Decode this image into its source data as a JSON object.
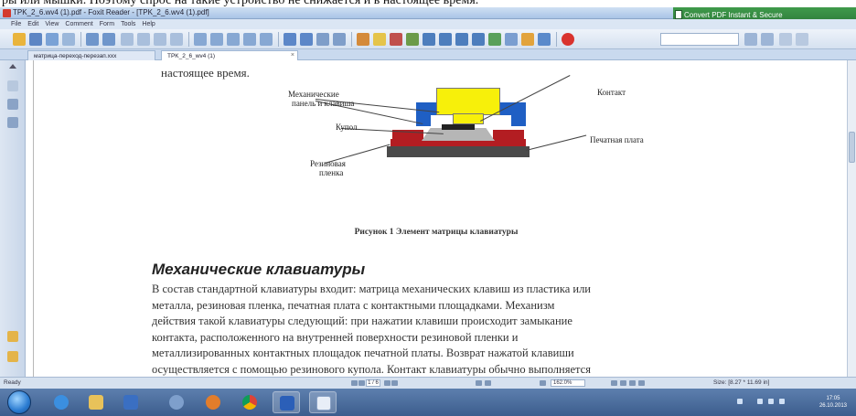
{
  "top_strip": {
    "text": "ры или мышки. Поэтому спрос на такие устройство не снижается и в настоящее время."
  },
  "window": {
    "title": "TPK_2_6.wv4 (1).pdf - Foxit Reader - [TPK_2_6.wv4 (1).pdf]"
  },
  "promo": {
    "label": "Convert PDF Instant & Secure"
  },
  "menu": {
    "items": [
      "File",
      "Edit",
      "View",
      "Comment",
      "Form",
      "Tools",
      "Help"
    ]
  },
  "tabs": [
    {
      "label": "матрица-переход-перезап.xxx"
    },
    {
      "label": "TPK_2_6_wv4 (1)"
    }
  ],
  "document": {
    "previous_line": "настоящее время.",
    "figure": {
      "labels": {
        "mech_plunger": "Механические\nпанель и клавиша",
        "contact": "Контакт",
        "dome": "Купол",
        "rubber_film": "Резиновая\nпленка",
        "pcb": "Печатная плата"
      },
      "caption": "Рисунок 1 Элемент матрицы клавиатуры",
      "colors": {
        "key": "#f7f00a",
        "panel": "#1f5fc4",
        "rubber": "#b31d22",
        "dome": "#b6b6b6",
        "contact": "#222222",
        "pcb": "#4a4a4a"
      }
    },
    "section_heading": "Механические клавиатуры",
    "paragraph_lines": [
      "В состав стандартной клавиатуры входит: матрица механических клавиш из пластика или",
      "металла, резиновая пленка, печатная плата с контактными площадками. Механизм",
      "действия такой клавиатуры следующий: при нажатии клавиши происходит замыкание",
      "контакта, расположенного на внутренней поверхности резиновой пленки и",
      "металлизированных контактных площадок печатной платы. Возврат нажатой клавиши",
      "осуществляется с помощью резинового купола. Контакт клавиатуры обычно выполняется"
    ]
  },
  "statusbar": {
    "state": "Ready",
    "page": "1 / 6",
    "zoom": "162.0%",
    "size": "Size: [8.27 * 11.69 in]"
  },
  "taskbar": {
    "clock_time": "17:05",
    "clock_date": "26.10.2013"
  }
}
